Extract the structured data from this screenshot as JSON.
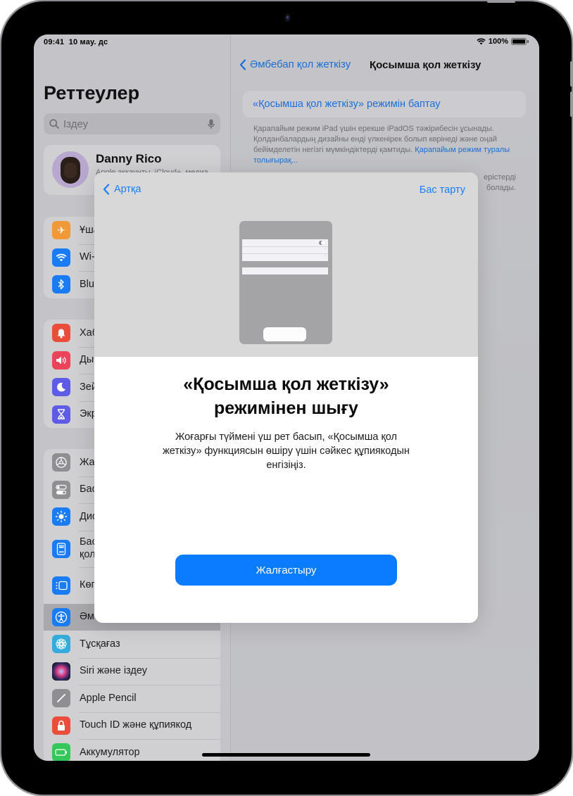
{
  "status_bar": {
    "time": "09:41",
    "date": "10 мау. дс",
    "battery": "100%",
    "battery_level_percent": 100
  },
  "sidebar": {
    "title": "Реттеулер",
    "search_placeholder": "Іздеу",
    "profile": {
      "name": "Danny Rico",
      "subtitle": "Apple аккаунты, iCloud+, медиа"
    },
    "groups": [
      {
        "items": [
          {
            "label": "Ұшақ режимі",
            "icon": "airplane-icon",
            "color": "#f09a37"
          },
          {
            "label": "Wi-Fi",
            "icon": "wifi-icon",
            "color": "#1a7cf5"
          },
          {
            "label": "Bluetooth",
            "icon": "bluetooth-icon",
            "color": "#1a7cf5"
          }
        ]
      },
      {
        "items": [
          {
            "label": "Хабарландырулар",
            "icon": "notifications-icon",
            "color": "#eb4d3d"
          },
          {
            "label": "Дыбыстар",
            "icon": "sounds-icon",
            "color": "#eb445a"
          },
          {
            "label": "Зейін",
            "icon": "focus-icon",
            "color": "#5e5ce6"
          },
          {
            "label": "Экран уақыты",
            "icon": "screen-time-icon",
            "color": "#5e5ce6"
          }
        ]
      },
      {
        "items": [
          {
            "label": "Жалпы",
            "icon": "general-icon",
            "color": "#8e8e93"
          },
          {
            "label": "Басқару орталығы",
            "icon": "control-center-icon",
            "color": "#8e8e93"
          },
          {
            "label": "Дисплей және жарықтық",
            "icon": "display-icon",
            "color": "#1a7cf5"
          },
          {
            "label": "Басты экран және қолданбалар",
            "icon": "home-screen-icon",
            "color": "#1a7cf5"
          },
          {
            "label": "Көп тапсырма және перне",
            "icon": "multitasking-icon",
            "color": "#1a7cf5"
          },
          {
            "label": "Әмбебап қол жеткізу",
            "icon": "accessibility-icon",
            "color": "#1a7cf5",
            "selected": true
          },
          {
            "label": "Тұсқағаз",
            "icon": "wallpaper-icon",
            "color": "#35aadc"
          },
          {
            "label": "Siri және іздеу",
            "icon": "siri-icon",
            "color": "#2a2a3a"
          },
          {
            "label": "Apple Pencil",
            "icon": "pencil-icon",
            "color": "#8e8e93"
          },
          {
            "label": "Touch ID және құпиякод",
            "icon": "lock-icon",
            "color": "#eb4d3d"
          },
          {
            "label": "Аккумулятор",
            "icon": "battery-icon",
            "color": "#34c759"
          }
        ]
      }
    ]
  },
  "detail": {
    "back_label": "Әмбебап қол жеткізу",
    "title": "Қосымша қол жеткізу",
    "setup_label": "«Қосымша қол жеткізу» режимін баптау",
    "description": "Қарапайым режим iPad үшін ерекше iPadOS тәжірибесін ұсынады. Қолданбалардың дизайны енді үлкенірек болып көрінеді және оңай бейімделетін негізгі мүмкіндіктерді қамтиды.",
    "description_link": "Қарапайым режим туралы толығырақ...",
    "description2_line1": "ерістерді",
    "description2_line2": "болады."
  },
  "modal": {
    "back_label": "Артқа",
    "cancel_label": "Бас тарту",
    "title_line1": "«Қосымша қол жеткізу»",
    "title_line2": "режимінен шығу",
    "body": "Жоғарғы түймені үш рет басып, «Қосымша қол жеткізу» функциясын өшіру үшін сәйкес құпиякодын енгізіңіз.",
    "continue_label": "Жалғастыру"
  },
  "colors": {
    "accent": "#0a7cff",
    "link": "#1a6fd6"
  }
}
